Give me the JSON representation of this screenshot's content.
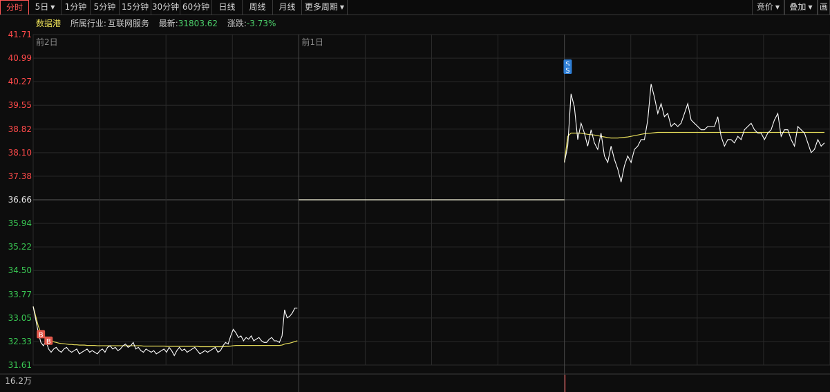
{
  "toolbar": {
    "left": [
      {
        "label": "分时",
        "active": true
      },
      {
        "label": "5日",
        "dropdown": true
      },
      {
        "label": "1分钟"
      },
      {
        "label": "5分钟"
      },
      {
        "label": "15分钟"
      },
      {
        "label": "30分钟"
      },
      {
        "label": "60分钟"
      },
      {
        "label": "日线"
      },
      {
        "label": "周线"
      },
      {
        "label": "月线"
      },
      {
        "label": "更多周期",
        "dropdown": true
      }
    ],
    "right": [
      {
        "label": "竞价",
        "dropdown": true
      },
      {
        "label": "叠加",
        "dropdown": true
      },
      {
        "label": "画"
      }
    ]
  },
  "info": {
    "stock_name": "数据港",
    "industry_label": "所属行业:",
    "industry": "互联网服务",
    "latest_label": "最新:",
    "latest": "31803.62",
    "change_label": "涨跌:",
    "change": "-3.73%"
  },
  "colors": {
    "up": "#ff4a4a",
    "down": "#39c853",
    "neutral": "#e8e8e8",
    "price_line": "#ffffff",
    "avg_line": "#e6dd5a",
    "grid": "#2a2a2a",
    "buy_marker": "#e0574a",
    "sell_marker": "#2f7fd6"
  },
  "chart_data": {
    "type": "line",
    "y_ticks": [
      "41.71",
      "40.99",
      "40.27",
      "39.55",
      "38.82",
      "38.10",
      "37.38",
      "36.66",
      "35.94",
      "35.22",
      "34.50",
      "33.77",
      "33.05",
      "32.33",
      "31.61"
    ],
    "prev_close": 36.66,
    "ylim": [
      31.61,
      41.71
    ],
    "days": [
      {
        "label": "前2日"
      },
      {
        "label": "前1日"
      },
      {
        "label": ""
      }
    ],
    "volume_top_label": "16.2万",
    "series": [
      {
        "day": 0,
        "price": [
          33.4,
          33.0,
          32.6,
          32.3,
          32.2,
          32.35,
          32.1,
          32.0,
          32.1,
          32.15,
          32.05,
          32.0,
          32.1,
          32.15,
          32.05,
          32.0,
          32.05,
          32.1,
          31.95,
          32.0,
          32.05,
          32.1,
          32.0,
          32.05,
          32.0,
          31.95,
          32.05,
          32.1,
          32.0,
          32.15,
          32.2,
          32.1,
          32.15,
          32.05,
          32.1,
          32.2,
          32.25,
          32.15,
          32.2,
          32.3,
          32.1,
          32.15,
          32.05,
          32.0,
          32.1,
          32.05,
          32.0,
          32.05,
          31.95,
          32.0,
          32.05,
          32.1,
          32.0,
          32.15,
          32.05,
          31.9,
          32.05,
          32.15,
          32.05,
          32.1,
          32.0,
          32.05,
          32.1,
          32.15,
          32.05,
          31.95,
          32.0,
          32.05,
          32.0,
          32.05,
          32.1,
          32.15,
          32.0,
          32.05,
          32.2,
          32.3,
          32.25,
          32.5,
          32.7,
          32.6,
          32.45,
          32.5,
          32.35,
          32.45,
          32.4,
          32.5,
          32.35,
          32.4,
          32.45,
          32.35,
          32.3,
          32.3,
          32.4,
          32.45,
          32.35,
          32.35,
          32.3,
          32.5,
          33.3,
          33.05,
          33.1,
          33.2,
          33.35,
          33.35
        ],
        "avg": [
          33.4,
          33.1,
          32.8,
          32.6,
          32.5,
          32.45,
          32.4,
          32.35,
          32.32,
          32.3,
          32.28,
          32.27,
          32.26,
          32.25,
          32.24,
          32.24,
          32.23,
          32.23,
          32.22,
          32.22,
          32.22,
          32.21,
          32.21,
          32.21,
          32.21,
          32.2,
          32.2,
          32.2,
          32.2,
          32.2,
          32.2,
          32.2,
          32.2,
          32.2,
          32.2,
          32.2,
          32.2,
          32.2,
          32.2,
          32.2,
          32.2,
          32.2,
          32.2,
          32.19,
          32.19,
          32.19,
          32.19,
          32.19,
          32.19,
          32.19,
          32.19,
          32.19,
          32.18,
          32.18,
          32.18,
          32.18,
          32.18,
          32.18,
          32.18,
          32.18,
          32.18,
          32.18,
          32.18,
          32.18,
          32.18,
          32.17,
          32.17,
          32.17,
          32.17,
          32.17,
          32.17,
          32.17,
          32.17,
          32.17,
          32.17,
          32.18,
          32.18,
          32.19,
          32.2,
          32.21,
          32.21,
          32.21,
          32.21,
          32.21,
          32.21,
          32.21,
          32.21,
          32.21,
          32.21,
          32.21,
          32.21,
          32.21,
          32.21,
          32.21,
          32.21,
          32.21,
          32.21,
          32.22,
          32.25,
          32.27,
          32.28,
          32.3,
          32.33,
          32.35
        ]
      },
      {
        "day": 1,
        "price": [
          36.66,
          36.66
        ],
        "avg": [
          36.66,
          36.66
        ]
      },
      {
        "day": 2,
        "price": [
          37.8,
          38.3,
          39.9,
          39.5,
          38.5,
          39.0,
          38.7,
          38.3,
          38.8,
          38.4,
          38.2,
          38.7,
          38.0,
          37.8,
          38.3,
          37.9,
          37.6,
          37.2,
          37.7,
          38.0,
          37.8,
          38.2,
          38.3,
          38.5,
          38.5,
          39.1,
          40.2,
          39.8,
          39.3,
          39.6,
          39.2,
          39.3,
          38.9,
          39.0,
          38.9,
          39.0,
          39.3,
          39.6,
          39.1,
          39.0,
          38.9,
          38.8,
          38.8,
          38.9,
          38.9,
          38.9,
          39.2,
          38.6,
          38.3,
          38.5,
          38.5,
          38.4,
          38.6,
          38.5,
          38.8,
          38.9,
          39.0,
          38.8,
          38.7,
          38.7,
          38.5,
          38.7,
          38.8,
          39.1,
          39.3,
          38.6,
          38.8,
          38.8,
          38.5,
          38.3,
          38.9,
          38.8,
          38.7,
          38.4,
          38.1,
          38.2,
          38.5,
          38.3,
          38.4
        ],
        "avg": [
          37.8,
          38.6,
          38.7,
          38.7,
          38.7,
          38.7,
          38.68,
          38.66,
          38.65,
          38.64,
          38.62,
          38.6,
          38.58,
          38.56,
          38.55,
          38.55,
          38.55,
          38.56,
          38.57,
          38.58,
          38.6,
          38.62,
          38.64,
          38.66,
          38.68,
          38.69,
          38.7,
          38.71,
          38.72,
          38.72,
          38.72,
          38.72,
          38.72,
          38.72,
          38.72,
          38.72,
          38.72,
          38.72,
          38.72,
          38.72,
          38.72,
          38.72,
          38.72,
          38.72,
          38.72,
          38.72,
          38.72,
          38.72,
          38.72,
          38.72,
          38.72,
          38.72,
          38.72,
          38.72,
          38.72,
          38.72,
          38.72,
          38.72,
          38.72,
          38.72,
          38.72,
          38.72,
          38.72,
          38.72,
          38.72,
          38.72,
          38.72,
          38.72,
          38.72,
          38.72,
          38.72,
          38.72,
          38.72,
          38.72,
          38.72,
          38.72,
          38.72,
          38.72,
          38.72
        ]
      }
    ],
    "markers": [
      {
        "label": "B",
        "kind": "buy",
        "day": 0,
        "index": 3
      },
      {
        "label": "B",
        "kind": "buy",
        "day": 0,
        "index": 6
      },
      {
        "label": "S",
        "kind": "sell",
        "day": 2,
        "index": 1
      },
      {
        "label": "S",
        "kind": "sell",
        "day": 2,
        "index": 1
      }
    ]
  }
}
